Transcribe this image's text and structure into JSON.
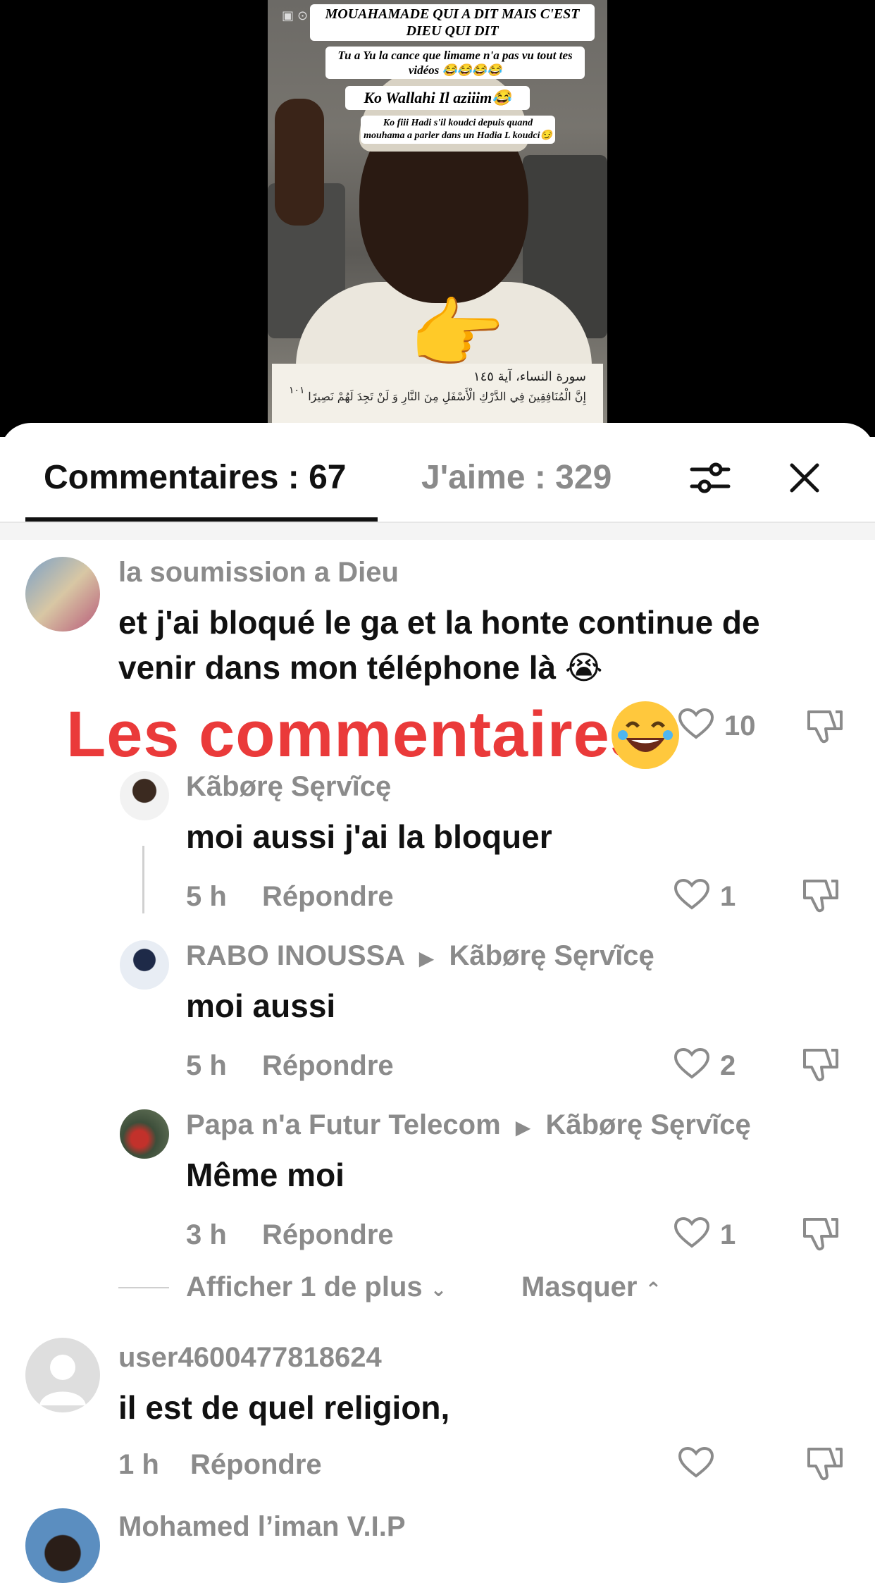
{
  "video": {
    "caption1": "MOUAHAMADE QUI A DIT MAIS C'EST DIEU QUI DIT",
    "caption2": "Tu a Yu la cance que limame n'a pas vu tout tes vidéos 😂😂😂😂",
    "caption3": "Ko Wallahi Il aziiim😂",
    "caption4": "Ko fiii Hadi s'il koudci depuis quand mouhama a parler dans un Hadia L koudci😏",
    "quran_ref": "سورة النساء، آية ١٤٥",
    "quran_verse": "إِنَّ الْمُنَافِقِينَ فِي الدَّرْكِ الْأَسْفَلِ مِنَ النَّارِ وَ لَنْ تَجِدَ لَهُمْ نَصِيرًا",
    "quran_num": "١٠١"
  },
  "tabs": {
    "comments": "Commentaires : 67",
    "likes": "J'aime : 329"
  },
  "overlay": {
    "text": "Les commentaires"
  },
  "comments": [
    {
      "user": "la soumission a Dieu",
      "text_line1": "et j'ai bloqué le ga et la honte continue de",
      "text_line2": "venir dans mon téléphone là 😭",
      "likes": "10"
    },
    {
      "user": "Kãbørę Sęrvĩcę",
      "text": "moi aussi j'ai la bloquer",
      "time": "5 h",
      "reply": "Répondre",
      "likes": "1"
    },
    {
      "user": "RABO INOUSSA",
      "reply_to": "Kãbørę Sęrvĩcę",
      "text": "moi aussi",
      "time": "5 h",
      "reply": "Répondre",
      "likes": "2"
    },
    {
      "user": "Papa n'a Futur Telecom",
      "reply_to": "Kãbørę Sęrvĩcę",
      "text": "Même moi",
      "time": "3 h",
      "reply": "Répondre",
      "likes": "1"
    },
    {
      "user": "user4600477818624",
      "text": "il est de quel religion,",
      "time": "1 h",
      "reply": "Répondre"
    },
    {
      "user": "Mohamed l’iman V.I.P"
    }
  ],
  "thread": {
    "show_more": "Afficher 1 de plus",
    "hide": "Masquer"
  },
  "colors": {
    "overlay_red": "#ea3a3a",
    "muted_gray": "#8b8b8b",
    "text_dark": "#111111"
  }
}
